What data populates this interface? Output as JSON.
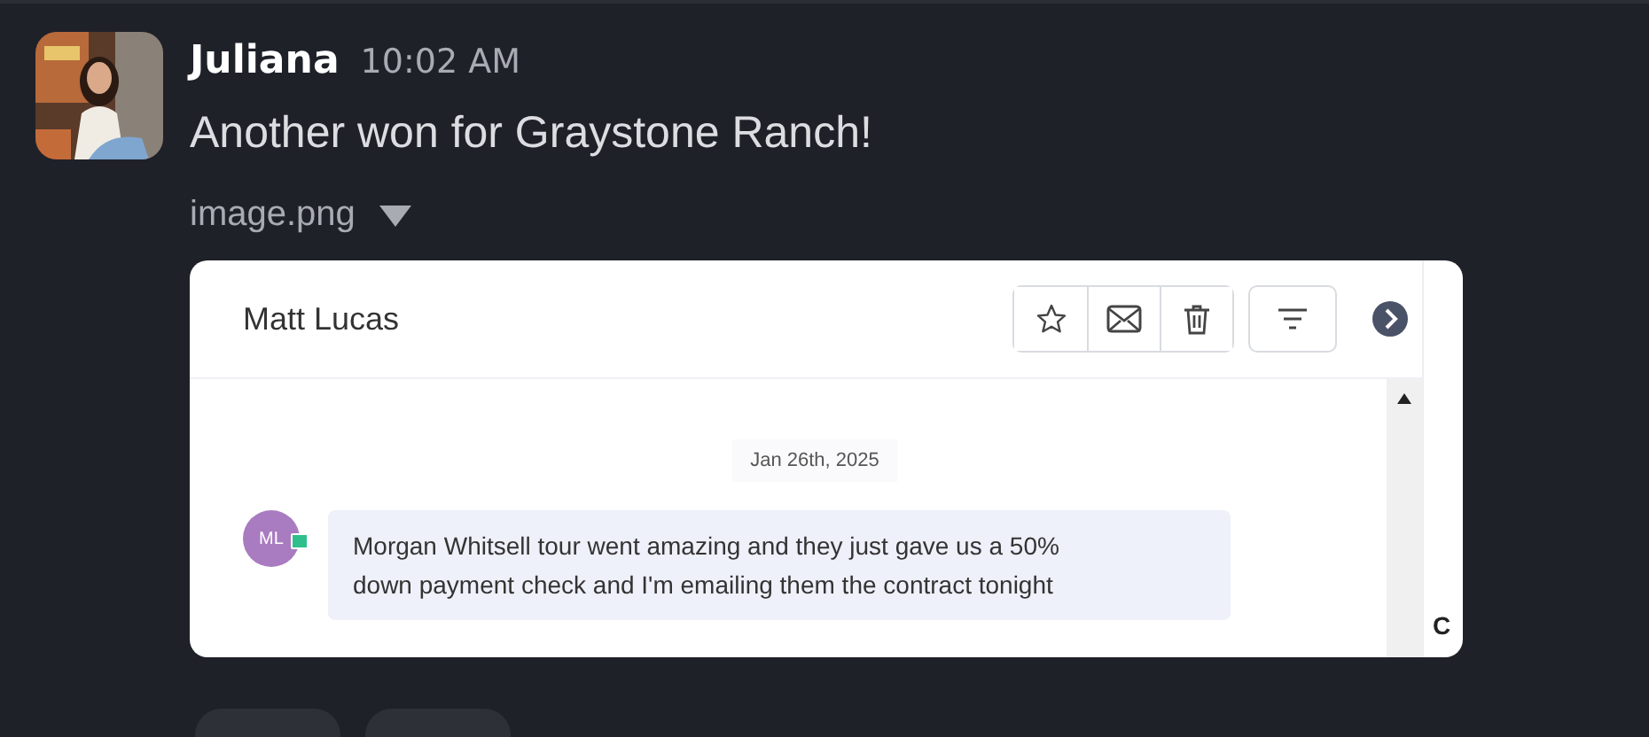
{
  "message": {
    "author": "Juliana",
    "time": "10:02 AM",
    "text": "Another won for Graystone Ranch!",
    "attachment": {
      "name": "image.png",
      "expanded": true
    }
  },
  "screenshot": {
    "title": "Matt Lucas",
    "date": "Jan 26th, 2025",
    "chat": {
      "initials": "ML",
      "text": "Morgan Whitsell tour went amazing and they just gave us a 50% down payment check and I'm emailing them the contract tonight"
    },
    "side_panel": {
      "column_1": "C"
    }
  }
}
